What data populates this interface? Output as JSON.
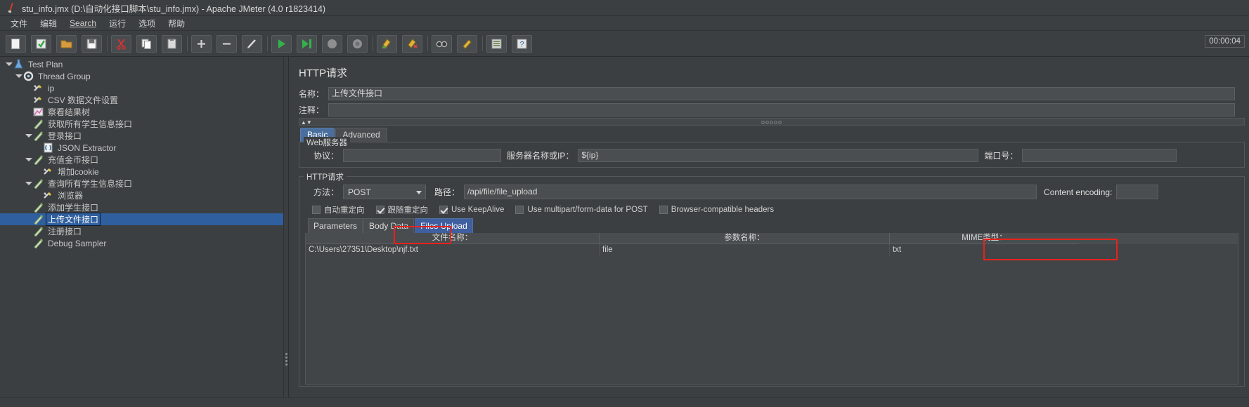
{
  "window": {
    "title": "stu_info.jmx (D:\\自动化接口脚本\\stu_info.jmx) - Apache JMeter (4.0 r1823414)",
    "logo_icon": "jmeter-feather-icon"
  },
  "menubar": {
    "items": [
      {
        "label": "文件"
      },
      {
        "label": "编辑"
      },
      {
        "label": "Search",
        "mnemonic": "S"
      },
      {
        "label": "运行"
      },
      {
        "label": "选项"
      },
      {
        "label": "帮助"
      }
    ]
  },
  "toolbar": {
    "timer": "00:00:04",
    "buttons": [
      {
        "name": "new-button",
        "icon": "new-document-icon"
      },
      {
        "name": "templates-button",
        "icon": "templates-icon"
      },
      {
        "name": "open-button",
        "icon": "open-folder-icon"
      },
      {
        "name": "save-button",
        "icon": "save-disk-icon"
      },
      {
        "name": "cut-button",
        "icon": "scissors-icon"
      },
      {
        "name": "copy-button",
        "icon": "copy-icon"
      },
      {
        "name": "paste-button",
        "icon": "clipboard-icon"
      },
      {
        "name": "expand-all-button",
        "icon": "plus-icon"
      },
      {
        "name": "collapse-all-button",
        "icon": "minus-icon"
      },
      {
        "name": "toggle-button",
        "icon": "toggle-pencil-icon"
      },
      {
        "name": "start-button",
        "icon": "play-green-icon"
      },
      {
        "name": "start-no-pauses-button",
        "icon": "play-no-pause-icon"
      },
      {
        "name": "stop-button",
        "icon": "stop-grey-icon"
      },
      {
        "name": "shutdown-button",
        "icon": "shutdown-grey-icon"
      },
      {
        "name": "clear-button",
        "icon": "broom-icon"
      },
      {
        "name": "clear-all-button",
        "icon": "broom-all-icon"
      },
      {
        "name": "search-button",
        "icon": "binoculars-icon"
      },
      {
        "name": "reset-search-button",
        "icon": "reset-search-icon"
      },
      {
        "name": "function-helper-button",
        "icon": "function-helper-icon"
      },
      {
        "name": "help-button",
        "icon": "help-question-icon"
      }
    ]
  },
  "tree": {
    "items": [
      {
        "label": "Test Plan",
        "indent": 0,
        "twisty": "open",
        "icon": "test-plan-icon",
        "selected": false
      },
      {
        "label": "Thread Group",
        "indent": 1,
        "twisty": "open",
        "icon": "thread-group-icon",
        "selected": false
      },
      {
        "label": "ip",
        "indent": 2,
        "twisty": "none",
        "icon": "config-element-icon",
        "selected": false
      },
      {
        "label": "CSV 数据文件设置",
        "indent": 2,
        "twisty": "none",
        "icon": "config-element-icon",
        "selected": false
      },
      {
        "label": "察看结果树",
        "indent": 2,
        "twisty": "none",
        "icon": "view-results-tree-icon",
        "selected": false
      },
      {
        "label": "获取所有学生信息接口",
        "indent": 2,
        "twisty": "none",
        "icon": "http-sampler-icon",
        "selected": false
      },
      {
        "label": "登录接口",
        "indent": 2,
        "twisty": "open",
        "icon": "http-sampler-icon",
        "selected": false
      },
      {
        "label": "JSON Extractor",
        "indent": 3,
        "twisty": "none",
        "icon": "json-extractor-icon",
        "selected": false
      },
      {
        "label": "充值金币接口",
        "indent": 2,
        "twisty": "open",
        "icon": "http-sampler-icon",
        "selected": false
      },
      {
        "label": "增加cookie",
        "indent": 3,
        "twisty": "none",
        "icon": "config-element-icon",
        "selected": false
      },
      {
        "label": "查询所有学生信息接口",
        "indent": 2,
        "twisty": "open",
        "icon": "http-sampler-icon",
        "selected": false
      },
      {
        "label": "浏览器",
        "indent": 3,
        "twisty": "none",
        "icon": "config-element-icon",
        "selected": false
      },
      {
        "label": "添加学生接口",
        "indent": 2,
        "twisty": "none",
        "icon": "http-sampler-icon",
        "selected": false
      },
      {
        "label": "上传文件接口",
        "indent": 2,
        "twisty": "none",
        "icon": "http-sampler-icon",
        "selected": true
      },
      {
        "label": "注册接口",
        "indent": 2,
        "twisty": "none",
        "icon": "http-sampler-icon",
        "selected": false
      },
      {
        "label": "Debug Sampler",
        "indent": 2,
        "twisty": "none",
        "icon": "http-sampler-icon",
        "selected": false
      }
    ]
  },
  "editor": {
    "panel_title": "HTTP请求",
    "name_label": "名称：",
    "name_value": "上传文件接口",
    "comment_label": "注释：",
    "comment_value": "",
    "collapse_dots": "ooooo",
    "tabs": [
      {
        "label": "Basic",
        "active": true
      },
      {
        "label": "Advanced",
        "active": false
      }
    ],
    "web_server": {
      "legend": "Web服务器",
      "protocol_label": "协议：",
      "protocol_value": "",
      "server_label": "服务器名称或IP：",
      "server_value": "${ip}",
      "port_label": "端口号：",
      "port_value": ""
    },
    "http_request": {
      "legend": "HTTP请求",
      "method_label": "方法：",
      "method_value": "POST",
      "path_label": "路径：",
      "path_value": "/api/file/file_upload",
      "content_encoding_label": "Content encoding:",
      "content_encoding_value": "",
      "checkboxes": [
        {
          "label": "自动重定向",
          "checked": false
        },
        {
          "label": "跟随重定向",
          "checked": true
        },
        {
          "label": "Use KeepAlive",
          "checked": true
        },
        {
          "label": "Use multipart/form-data for POST",
          "checked": false
        },
        {
          "label": "Browser-compatible headers",
          "checked": false
        }
      ],
      "lower_tabs": [
        {
          "label": "Parameters",
          "active": false
        },
        {
          "label": "Body Data",
          "active": false
        },
        {
          "label": "Files Upload",
          "active": true
        }
      ],
      "table": {
        "columns": [
          "文件名称：",
          "参数名称：",
          "MIME类型："
        ],
        "rows": [
          [
            "C:\\Users\\27351\\Desktop\\njf.txt",
            "file",
            "txt"
          ]
        ]
      }
    }
  },
  "annotations": {
    "color": "#e8221c",
    "boxes": [
      {
        "name": "files-upload-tab-highlight"
      },
      {
        "name": "mime-type-column-highlight"
      }
    ]
  }
}
